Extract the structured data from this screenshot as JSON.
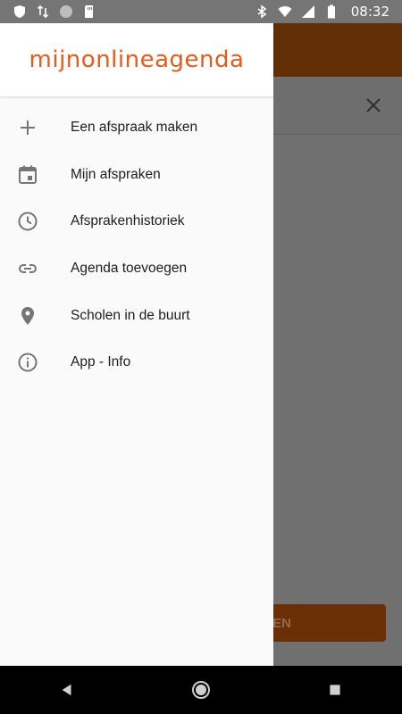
{
  "status_bar": {
    "time": "08:32",
    "icons": [
      "shield-icon",
      "data-arrows-icon",
      "circle-icon",
      "sd-card-icon",
      "bluetooth-icon",
      "wifi-icon",
      "signal-icon",
      "battery-icon"
    ]
  },
  "drawer": {
    "logo_text": "mijnonlineagenda",
    "items": [
      {
        "label": "Een afspraak maken",
        "icon": "plus-icon"
      },
      {
        "label": "Mijn afspraken",
        "icon": "calendar-icon"
      },
      {
        "label": "Afsprakenhistoriek",
        "icon": "clock-icon"
      },
      {
        "label": "Agenda toevoegen",
        "icon": "link-icon"
      },
      {
        "label": "Scholen in de buurt",
        "icon": "location-pin-icon"
      },
      {
        "label": "App - Info",
        "icon": "info-icon"
      }
    ]
  },
  "background": {
    "button_label_partial": "EN",
    "colors": {
      "appbar": "#622e06",
      "button": "#6b2f05"
    }
  },
  "colors": {
    "brand": "#e85a1a"
  },
  "nav_bar": {
    "icons": [
      "back-icon",
      "home-icon",
      "recents-icon"
    ]
  }
}
